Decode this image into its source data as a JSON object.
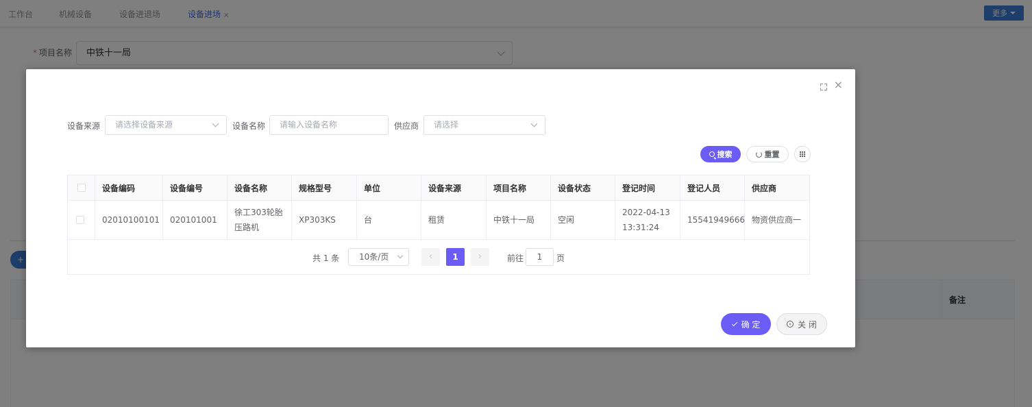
{
  "tabs": [
    {
      "label": "工作台",
      "active": false
    },
    {
      "label": "机械设备",
      "active": false
    },
    {
      "label": "设备进退场",
      "active": false
    },
    {
      "label": "设备进场",
      "active": true,
      "close": "×"
    }
  ],
  "header": {
    "more_label": "更多"
  },
  "form": {
    "project_label": "项目名称",
    "project_value": "中铁十一局"
  },
  "page": {
    "add_label": "+",
    "table_note_header": "备注"
  },
  "dialog": {
    "close_glyph": "×",
    "filters": {
      "source_label": "设备来源",
      "source_placeholder": "请选择设备来源",
      "name_label": "设备名称",
      "name_placeholder": "请输入设备名称",
      "supplier_label": "供应商",
      "supplier_placeholder": "请选择"
    },
    "toolbar": {
      "search_label": "搜索",
      "reset_label": "重置"
    },
    "table": {
      "columns": [
        "设备编码",
        "设备编号",
        "设备名称",
        "规格型号",
        "单位",
        "设备来源",
        "项目名称",
        "设备状态",
        "登记时间",
        "登记人员",
        "供应商"
      ],
      "rows": [
        [
          "02010100101",
          "020101001",
          "徐工303轮胎压路机",
          "XP303KS",
          "台",
          "租赁",
          "中铁十一局",
          "空闲",
          "2022-04-13 13:31:24",
          "15541949666",
          "物资供应商一"
        ]
      ]
    },
    "pagination": {
      "total_text": "共 1 条",
      "page_size": "10条/页",
      "current_page": "1",
      "prev_glyph": "‹",
      "next_glyph": "›",
      "goto_label": "前往",
      "goto_value": "1",
      "page_suffix": "页"
    },
    "footer": {
      "confirm_label": "确 定",
      "close_label": "关 闭"
    }
  },
  "colors": {
    "accent": "#6a5cf4",
    "more_button": "#3a7bd5"
  }
}
